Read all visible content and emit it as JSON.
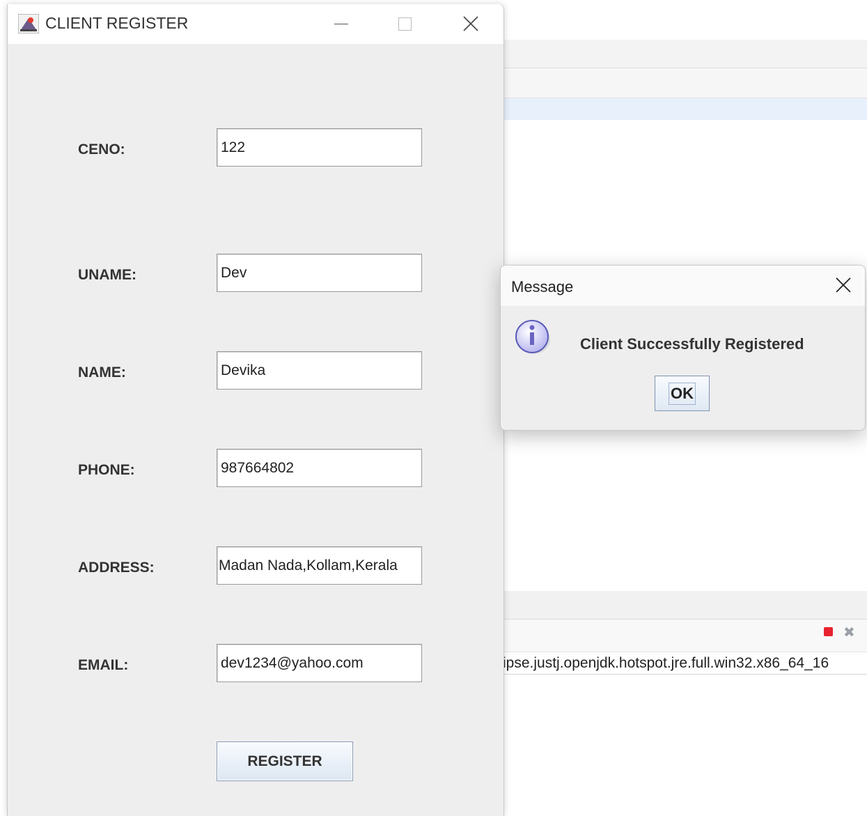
{
  "window": {
    "title": "CLIENT REGISTER"
  },
  "form": {
    "fields": [
      {
        "label": "CENO:",
        "value": "122"
      },
      {
        "label": "UNAME:",
        "value": "Dev"
      },
      {
        "label": "NAME:",
        "value": "Devika"
      },
      {
        "label": "PHONE:",
        "value": "987664802"
      },
      {
        "label": "ADDRESS:",
        "value": "Madan Nada,Kollam,Kerala"
      },
      {
        "label": "EMAIL:",
        "value": "dev1234@yahoo.com"
      }
    ],
    "register_label": "REGISTER"
  },
  "dialog": {
    "title": "Message",
    "message": "Client Successfully Registered",
    "ok_label": "OK",
    "icon": "info-icon"
  },
  "background": {
    "console_text": "ipse.justj.openjdk.hotspot.jre.full.win32.x86_64_16",
    "icons": [
      "stop-icon",
      "remove-icon"
    ],
    "stop_color": "#e8222e"
  }
}
